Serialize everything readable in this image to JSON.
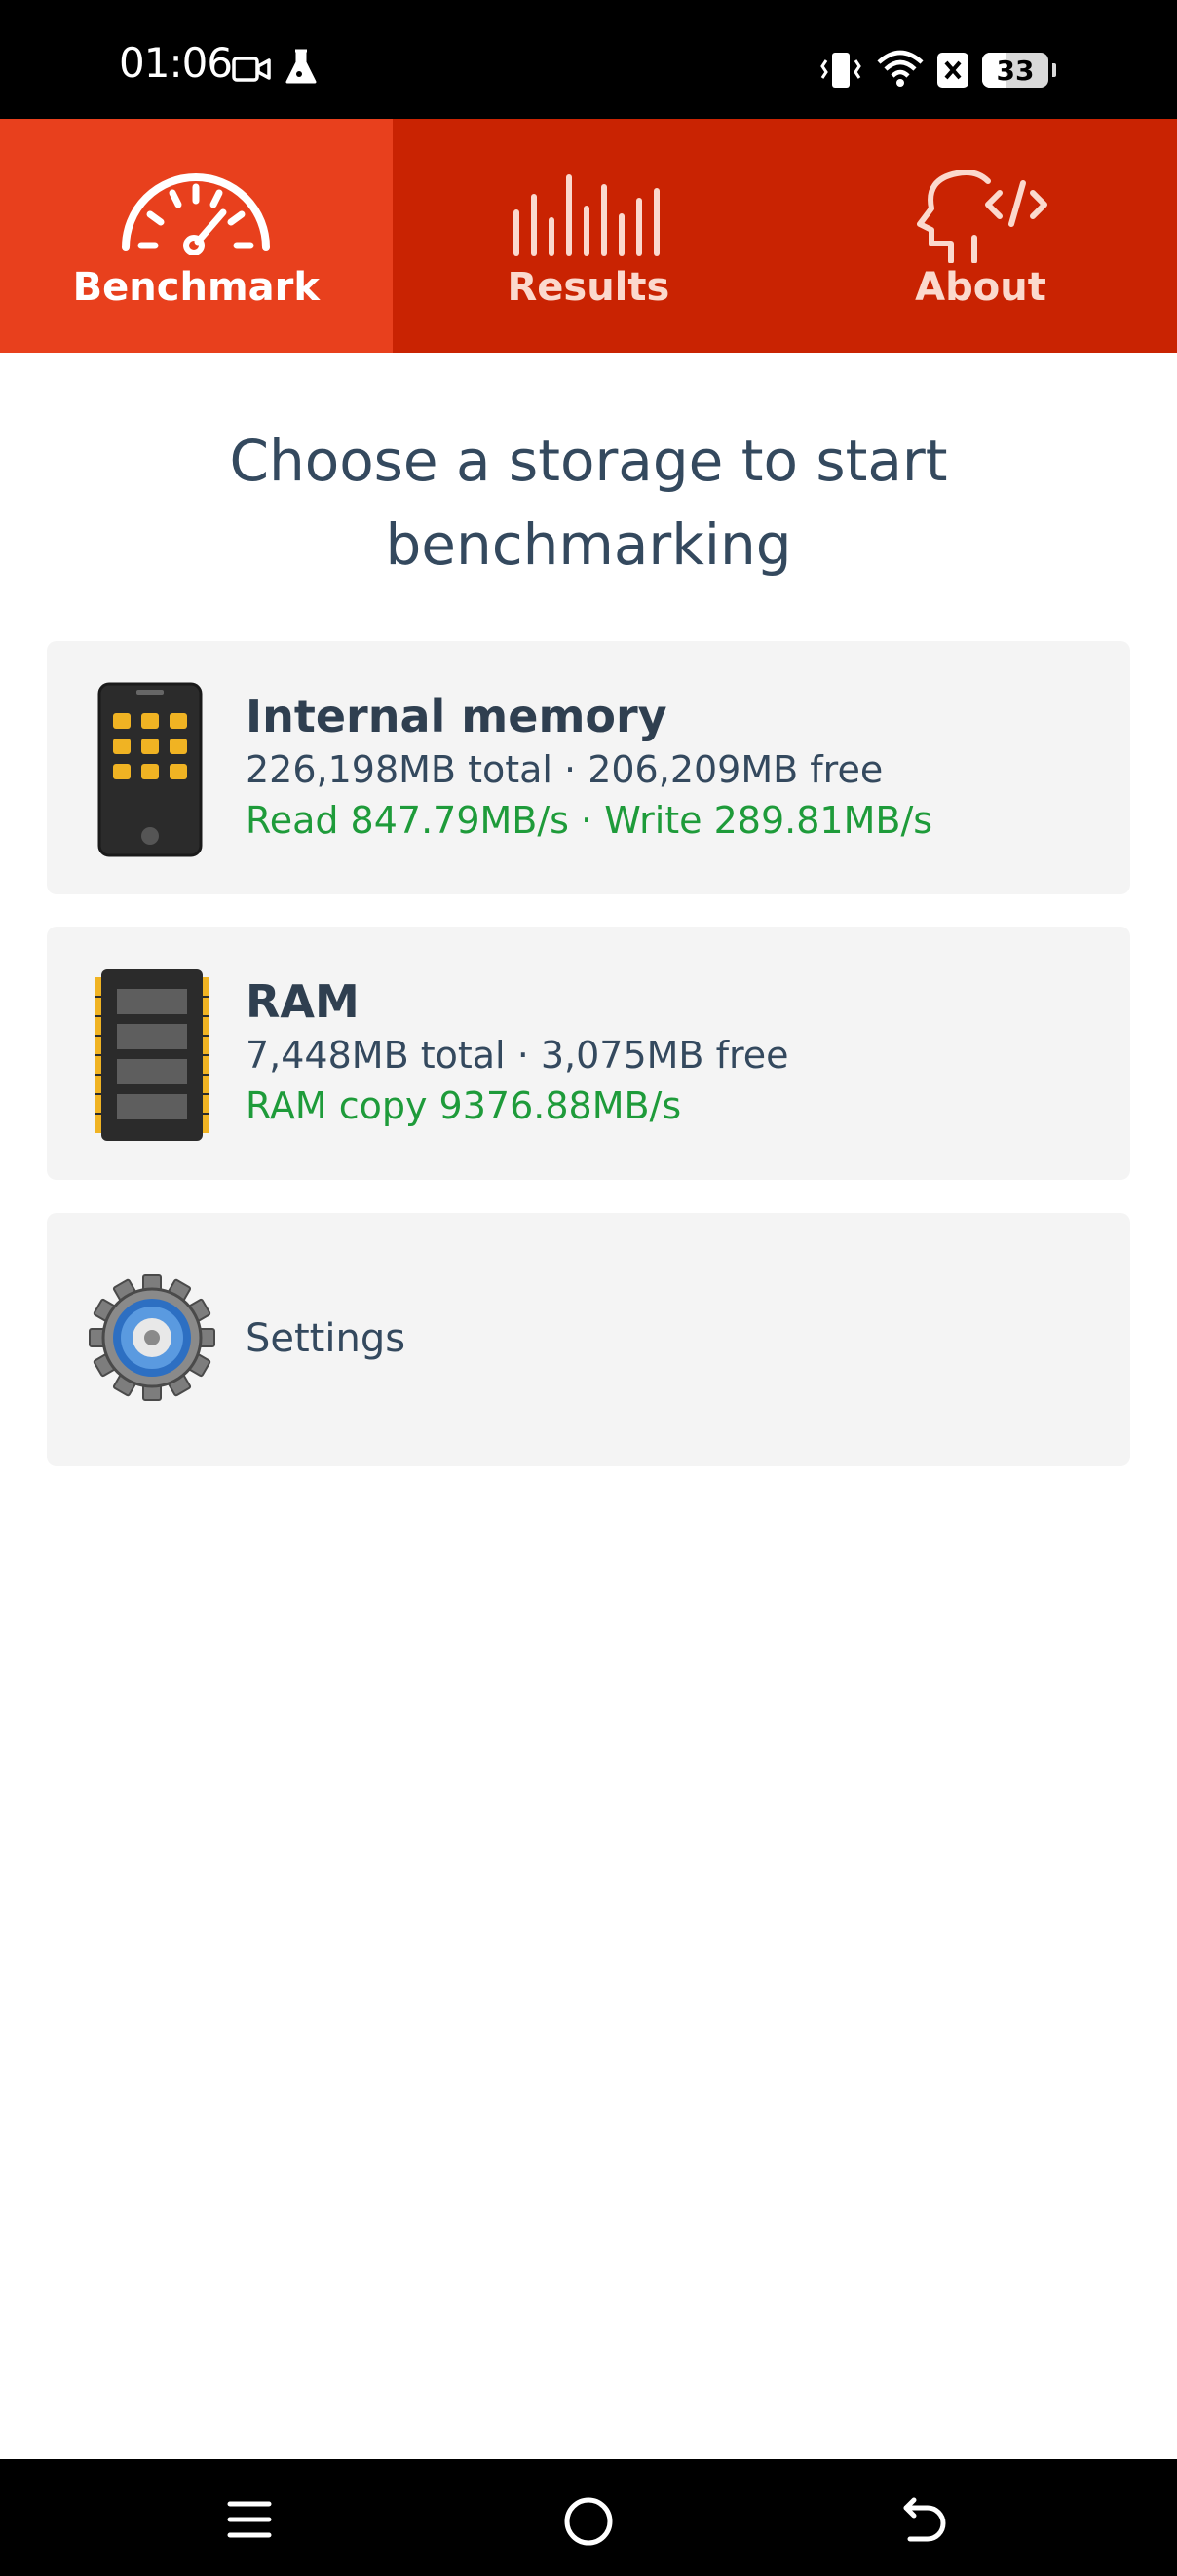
{
  "status_bar": {
    "time": "01:06",
    "icons": [
      "camera-icon",
      "flask-icon",
      "vibrate-icon",
      "wifi-icon",
      "sim-off-icon",
      "battery-icon"
    ],
    "battery_level": "33"
  },
  "tabs": [
    {
      "label": "Benchmark",
      "icon": "speedometer-icon",
      "active": true
    },
    {
      "label": "Results",
      "icon": "bar-lines-icon",
      "active": false
    },
    {
      "label": "About",
      "icon": "head-code-icon",
      "active": false
    }
  ],
  "heading": {
    "line1": "Choose a storage to start",
    "line2": "benchmarking"
  },
  "storages": [
    {
      "title": "Internal memory",
      "capacity": "226,198MB total · 206,209MB free",
      "speed": "Read 847.79MB/s · Write 289.81MB/s",
      "icon": "phone-icon"
    },
    {
      "title": "RAM",
      "capacity": "7,448MB total · 3,075MB free",
      "speed": "RAM copy 9376.88MB/s",
      "icon": "ram-chip-icon"
    }
  ],
  "settings": {
    "label": "Settings",
    "icon": "gear-icon"
  },
  "nav_bar": {
    "icons": [
      "menu-icon",
      "home-icon",
      "back-icon"
    ]
  },
  "colors": {
    "tab_bar": "#c92302",
    "tab_active": "#e8401d",
    "heading_text": "#34495e",
    "speed_text": "#1e9b3a",
    "card_bg": "#f4f4f4"
  }
}
